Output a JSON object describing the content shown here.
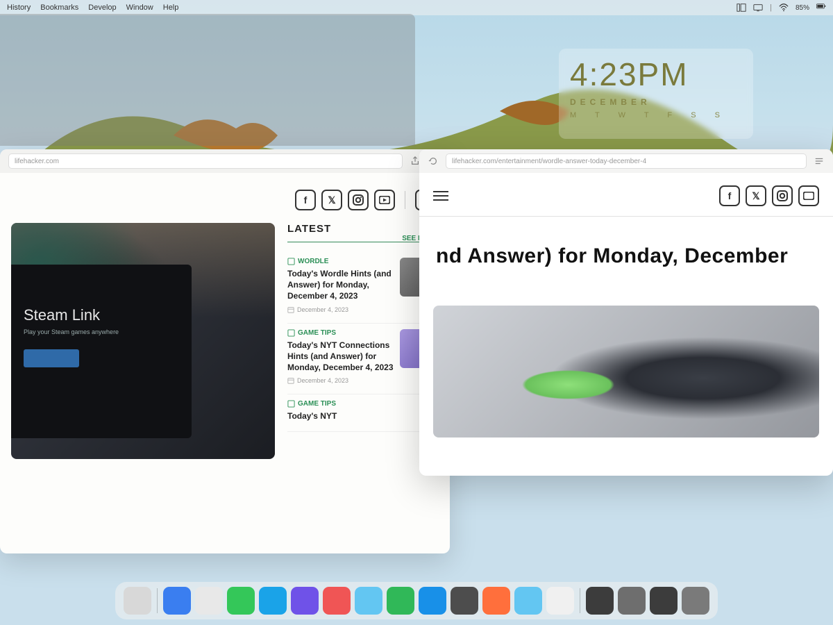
{
  "menubar": {
    "items": [
      "History",
      "Bookmarks",
      "Develop",
      "Window",
      "Help"
    ],
    "battery": "85%"
  },
  "widget": {
    "time": "4:23PM",
    "month": "DECEMBER",
    "days": "M T W T F S S"
  },
  "win1": {
    "address": "lifehacker.com",
    "hero_title": "Steam Link",
    "hero_sub": "Play your Steam games anywhere",
    "latest_label": "LATEST",
    "more_label": "SEE MORE",
    "items": [
      {
        "tag": "WORDLE",
        "title": "Today's Wordle Hints (and Answer) for Monday, December 4, 2023",
        "date": "December 4, 2023",
        "thumb": "#6e6e6e"
      },
      {
        "tag": "GAME TIPS",
        "title": "Today's NYT Connections Hints (and Answer) for Monday, December 4, 2023",
        "date": "December 4, 2023",
        "thumb": "#8f7fd1"
      },
      {
        "tag": "GAME TIPS",
        "title": "Today's NYT",
        "date": "",
        "thumb": ""
      }
    ]
  },
  "win2": {
    "address": "lifehacker.com/entertainment/wordle-answer-today-december-4",
    "headline": "nd Answer) for Monday, December "
  },
  "dock_colors": [
    "#d8d8d8",
    "#3a7ef0",
    "#e8e8e8",
    "#34c759",
    "#1aa3e8",
    "#6f52e8",
    "#f05555",
    "#63c6f2",
    "#30b858",
    "#1890e8",
    "#4d4d4d",
    "#ff6f3c",
    "#63c6f2",
    "#f0f0f0",
    "#3c3c3c",
    "#6e6e6e",
    "#3c3c3c",
    "#7a7a7a"
  ]
}
